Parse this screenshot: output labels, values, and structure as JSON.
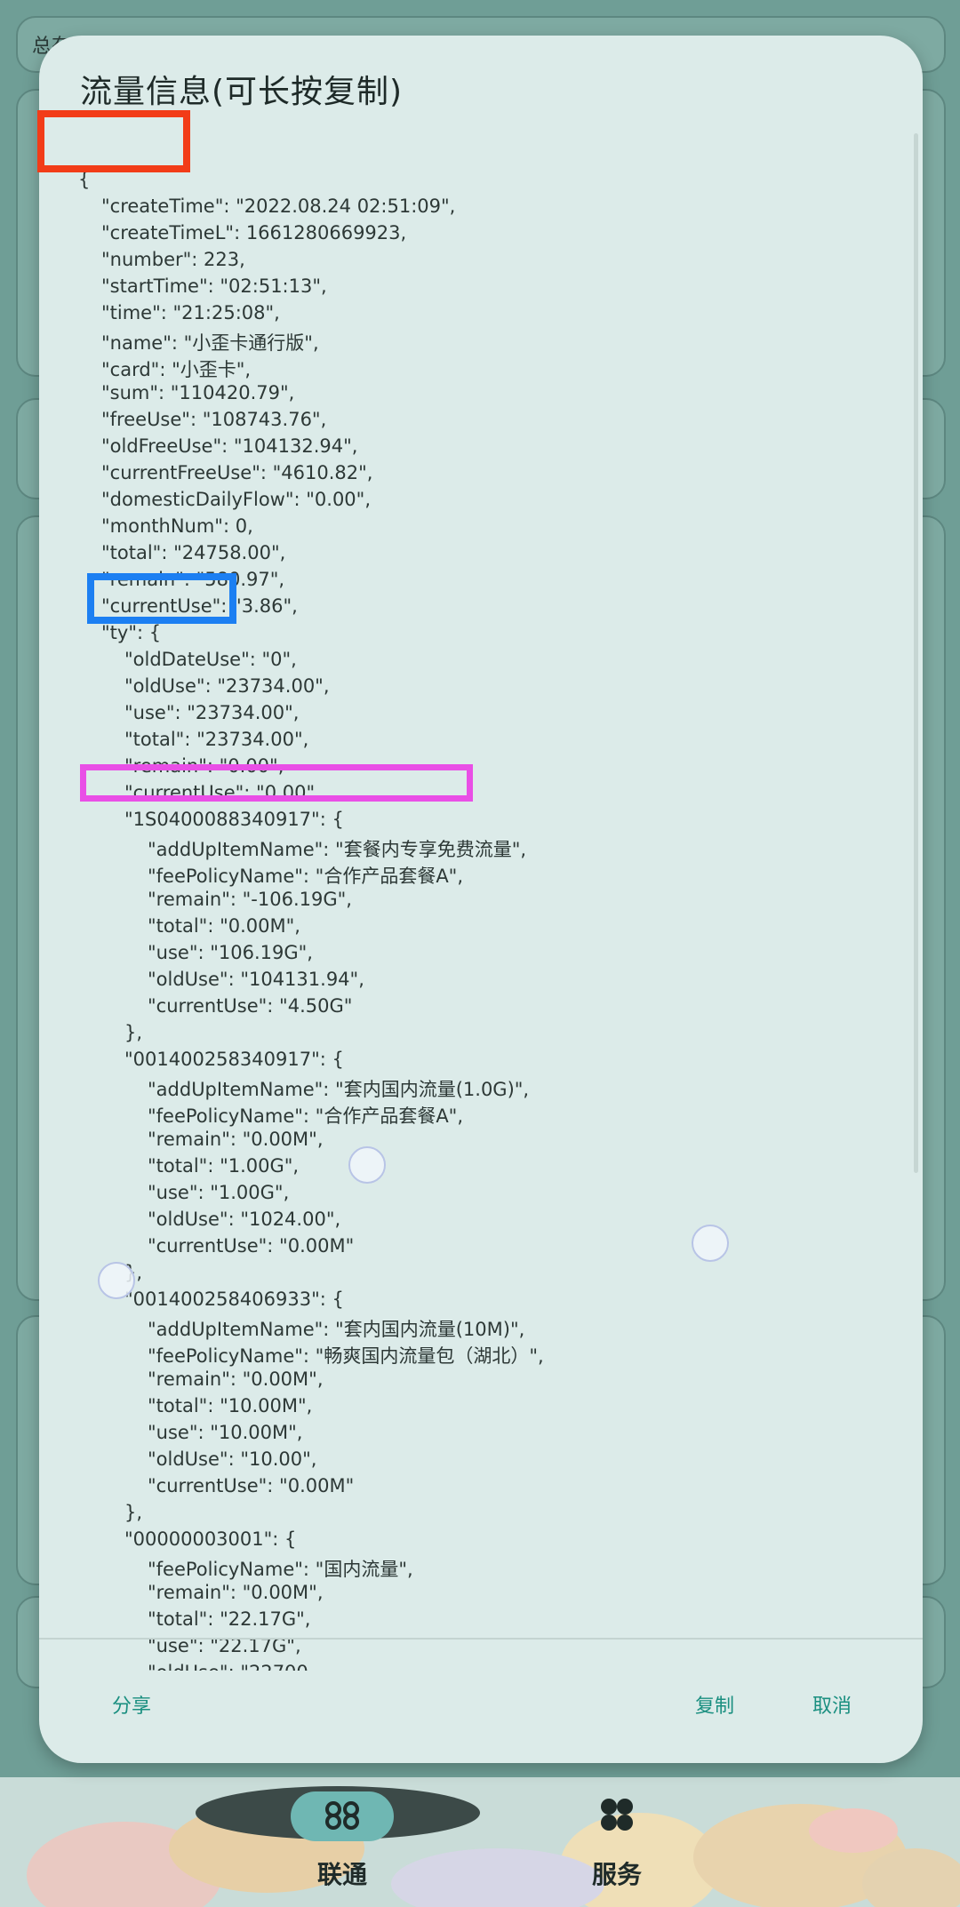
{
  "background": {
    "top_label": "总有"
  },
  "dialog": {
    "title": "流量信息(可长按复制)",
    "json_lines": [
      {
        "text": "{",
        "indent": 0
      },
      {
        "text": "\"createTime\": \"2022.08.24 02:51:09\",",
        "indent": 1
      },
      {
        "text": "\"createTimeL\": 1661280669923,",
        "indent": 1
      },
      {
        "text": "\"number\": 223,",
        "indent": 1
      },
      {
        "text": "\"startTime\": \"02:51:13\",",
        "indent": 1
      },
      {
        "text": "\"time\": \"21:25:08\",",
        "indent": 1
      },
      {
        "text": "\"name\": \"小歪卡通行版\",",
        "indent": 1
      },
      {
        "text": "\"card\": \"小歪卡\",",
        "indent": 1
      },
      {
        "text": "\"sum\": \"110420.79\",",
        "indent": 1
      },
      {
        "text": "\"freeUse\": \"108743.76\",",
        "indent": 1
      },
      {
        "text": "\"oldFreeUse\": \"104132.94\",",
        "indent": 1
      },
      {
        "text": "\"currentFreeUse\": \"4610.82\",",
        "indent": 1
      },
      {
        "text": "\"domesticDailyFlow\": \"0.00\",",
        "indent": 1
      },
      {
        "text": "\"monthNum\": 0,",
        "indent": 1
      },
      {
        "text": "\"total\": \"24758.00\",",
        "indent": 1
      },
      {
        "text": "\"remain\": \"580.97\",",
        "indent": 1
      },
      {
        "text": "\"currentUse\": \"3.86\",",
        "indent": 1
      },
      {
        "text": "\"ty\": {",
        "indent": 1
      },
      {
        "text": "\"oldDateUse\": \"0\",",
        "indent": 2
      },
      {
        "text": "\"oldUse\": \"23734.00\",",
        "indent": 2
      },
      {
        "text": "\"use\": \"23734.00\",",
        "indent": 2
      },
      {
        "text": "\"total\": \"23734.00\",",
        "indent": 2
      },
      {
        "text": "\"remain\": \"0.00\",",
        "indent": 2
      },
      {
        "text": "\"currentUse\": \"0.00\"",
        "indent": 2
      },
      {
        "text": "\"1S0400088340917\": {",
        "indent": 2
      },
      {
        "text": "\"addUpItemName\": \"套餐内专享免费流量\",",
        "indent": 3
      },
      {
        "text": "\"feePolicyName\": \"合作产品套餐A\",",
        "indent": 3
      },
      {
        "text": "\"remain\": \"-106.19G\",",
        "indent": 3
      },
      {
        "text": "\"total\": \"0.00M\",",
        "indent": 3
      },
      {
        "text": "\"use\": \"106.19G\",",
        "indent": 3
      },
      {
        "text": "\"oldUse\": \"104131.94\",",
        "indent": 3
      },
      {
        "text": "\"currentUse\": \"4.50G\"",
        "indent": 3
      },
      {
        "text": "},",
        "indent": 2
      },
      {
        "text": "\"001400258340917\": {",
        "indent": 2
      },
      {
        "text": "\"addUpItemName\": \"套内国内流量(1.0G)\",",
        "indent": 3
      },
      {
        "text": "\"feePolicyName\": \"合作产品套餐A\",",
        "indent": 3
      },
      {
        "text": "\"remain\": \"0.00M\",",
        "indent": 3
      },
      {
        "text": "\"total\": \"1.00G\",",
        "indent": 3
      },
      {
        "text": "\"use\": \"1.00G\",",
        "indent": 3
      },
      {
        "text": "\"oldUse\": \"1024.00\",",
        "indent": 3
      },
      {
        "text": "\"currentUse\": \"0.00M\"",
        "indent": 3
      },
      {
        "text": "},",
        "indent": 2
      },
      {
        "text": "\"001400258406933\": {",
        "indent": 2
      },
      {
        "text": "\"addUpItemName\": \"套内国内流量(10M)\",",
        "indent": 3
      },
      {
        "text": "\"feePolicyName\": \"畅爽国内流量包（湖北）\",",
        "indent": 3
      },
      {
        "text": "\"remain\": \"0.00M\",",
        "indent": 3
      },
      {
        "text": "\"total\": \"10.00M\",",
        "indent": 3
      },
      {
        "text": "\"use\": \"10.00M\",",
        "indent": 3
      },
      {
        "text": "\"oldUse\": \"10.00\",",
        "indent": 3
      },
      {
        "text": "\"currentUse\": \"0.00M\"",
        "indent": 3
      },
      {
        "text": "},",
        "indent": 2
      },
      {
        "text": "\"00000003001\": {",
        "indent": 2
      },
      {
        "text": "\"feePolicyName\": \"国内流量\",",
        "indent": 3
      },
      {
        "text": "\"remain\": \"0.00M\",",
        "indent": 3
      },
      {
        "text": "\"total\": \"22.17G\",",
        "indent": 3
      },
      {
        "text": "\"use\": \"22.17G\",",
        "indent": 3
      },
      {
        "text": "\"oldUse\": \"22700",
        "indent": 3
      }
    ],
    "share_label": "分享",
    "copy_label": "复制",
    "cancel_label": "取消"
  },
  "bottom_nav": {
    "items": [
      {
        "label": "联通",
        "icon": "unicom-knot-icon",
        "active": true
      },
      {
        "label": "服务",
        "icon": "clover-grid-icon",
        "active": false
      }
    ]
  },
  "colors": {
    "accent": "#1a8f80",
    "dialog_bg": "#dcebe9",
    "annotation_red": "#f23c18",
    "annotation_blue": "#1c7ff2",
    "annotation_magenta": "#e94fe6"
  }
}
